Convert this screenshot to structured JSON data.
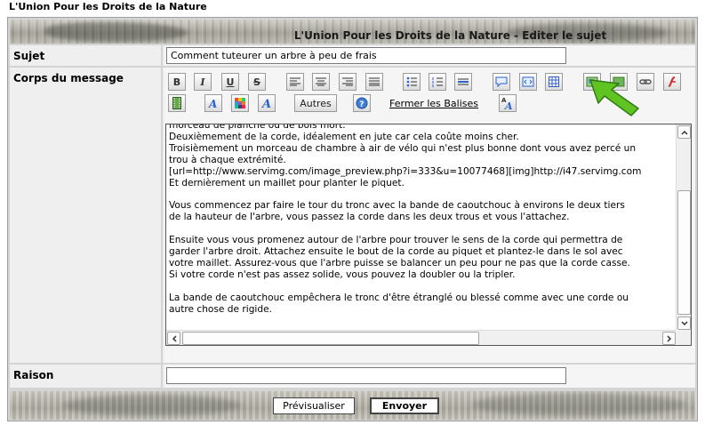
{
  "site": {
    "title": "L'Union Pour les Droits de la Nature"
  },
  "header": {
    "title": "L'Union Pour les Droits de la Nature - Editer le sujet"
  },
  "form": {
    "subject_label": "Sujet",
    "subject_value": "Comment tuteurer un arbre à peu de frais",
    "body_label": "Corps du message",
    "reason_label": "Raison",
    "reason_value": ""
  },
  "toolbar": {
    "bold": "B",
    "italic": "I",
    "underline": "U",
    "strike": "S",
    "others_label": "Autres",
    "help_label": "?",
    "close_tags_label": "Fermer les Balises",
    "font_size_label": "A"
  },
  "editor": {
    "content": "morceau de planche ou de bois mort.\nDeuxièmement de la corde, idéalement en jute car cela coûte moins cher.\nTroisièmement un morceau de chambre à air de vélo qui n'est plus bonne dont vous avez percé un\ntrou à chaque extrémité.\n[url=http://www.servimg.com/image_preview.php?i=333&u=10077468][img]http://i47.servimg.com\nEt dernièrement un maillet pour planter le piquet.\n\nVous commencez par faire le tour du tronc avec la bande de caoutchouc à environs le deux tiers\nde la hauteur de l'arbre, vous passez la corde dans les deux trous et vous l'attachez.\n\nEnsuite vous vous promenez autour de l'arbre pour trouver le sens de la corde qui permettra de\ngarder l'arbre droit. Attachez ensuite le bout de la corde au piquet et plantez-le dans le sol avec\nvotre maillet. Assurez-vous que l'arbre puisse se balancer un peu pour ne pas que la corde casse.\nSi votre corde n'est pas assez solide, vous pouvez la doubler ou la tripler.\n\nLa bande de caoutchouc empêchera le tronc d'être étranglé ou blessé comme avec une corde ou\nautre chose de rigide."
  },
  "actions": {
    "preview_label": "Prévisualiser",
    "submit_label": "Envoyer"
  },
  "colors": {
    "frame": "#d4d4d4",
    "cursor_arrow": "#5fc421"
  },
  "icons": [
    "align-left-icon",
    "align-center-icon",
    "align-right-icon",
    "justify-icon",
    "bullet-list-icon",
    "numbered-list-icon",
    "horizontal-rule-icon",
    "quote-icon",
    "code-icon",
    "table-icon",
    "insert-image-icon",
    "upload-image-icon",
    "link-icon",
    "flash-icon",
    "video-icon",
    "font-icon",
    "color-icon",
    "font-style-icon",
    "green-pointer-arrow"
  ]
}
